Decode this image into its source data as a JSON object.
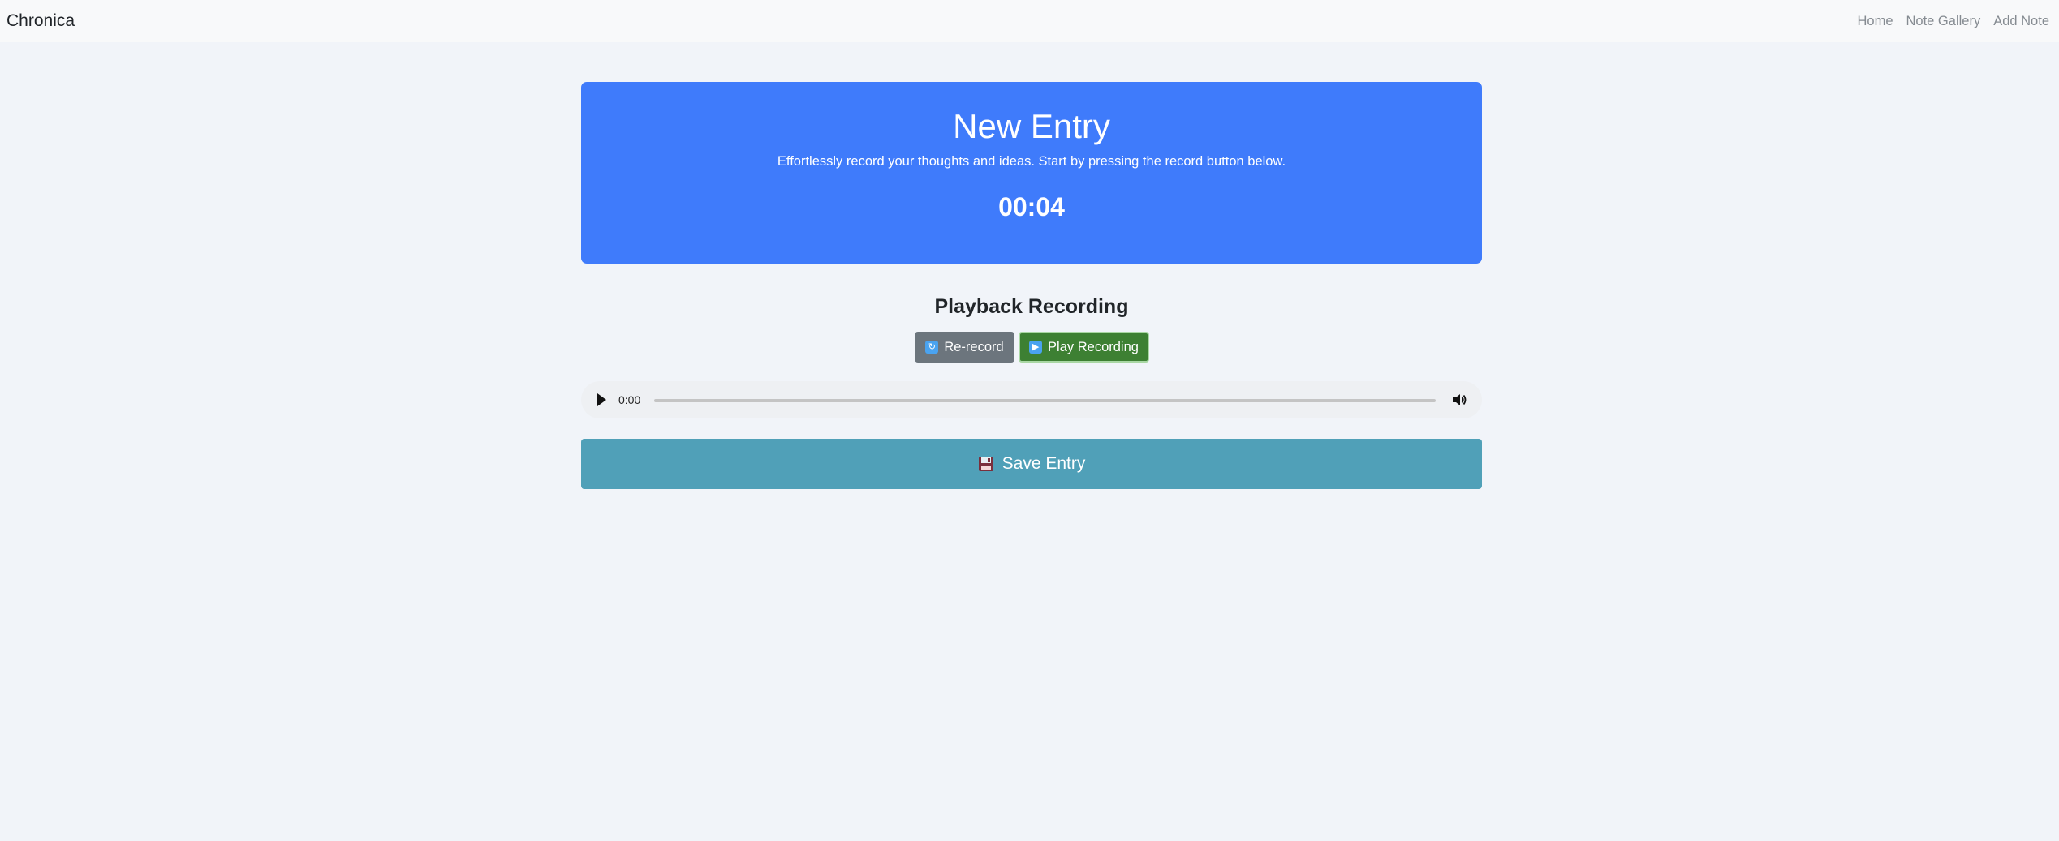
{
  "navbar": {
    "brand": "Chronica",
    "links": [
      "Home",
      "Note Gallery",
      "Add Note"
    ]
  },
  "hero": {
    "title": "New Entry",
    "subtitle": "Effortlessly record your thoughts and ideas. Start by pressing the record button below.",
    "timer": "00:04"
  },
  "playback": {
    "title": "Playback Recording",
    "rerecord_label": "Re-record",
    "rerecord_icon": "refresh-icon",
    "play_label": "Play Recording",
    "play_icon": "play-icon"
  },
  "audio": {
    "time": "0:00",
    "progress": 0
  },
  "save": {
    "label": "Save Entry",
    "icon": "floppy-disk-icon"
  },
  "colors": {
    "hero_bg": "#3f7bfb",
    "rerecord_bg": "#6c757d",
    "play_bg": "#3d8033",
    "save_bg": "#50a0b8",
    "page_bg": "#f1f4f9"
  }
}
